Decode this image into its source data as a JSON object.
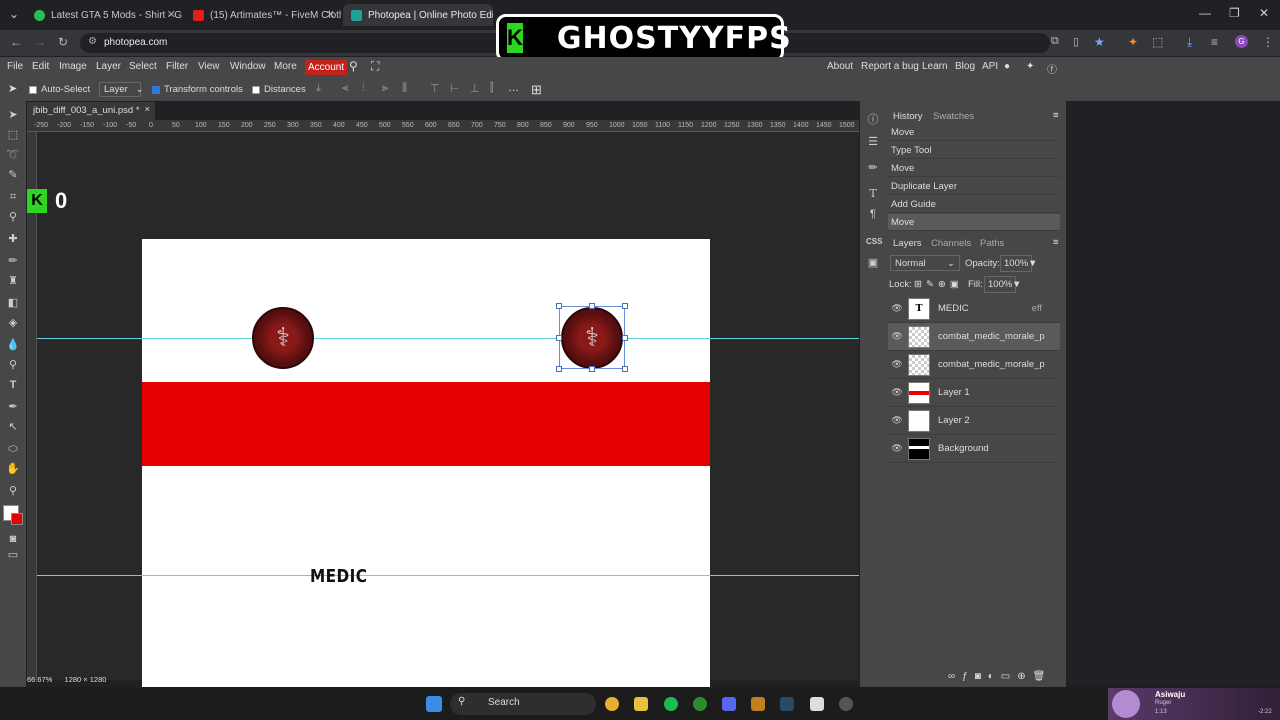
{
  "browser": {
    "tabs": [
      {
        "title": "Latest GTA 5 Mods - Shirt - GTA",
        "color": "#2dbd4e"
      },
      {
        "title": "(15) Artimates™ - FiveM Clothin",
        "color": "#e02020"
      },
      {
        "title": "Photopea | Online Photo Editor",
        "color": "#18a497"
      }
    ],
    "url": "photopea.com"
  },
  "overlay": {
    "logo_letter": "K",
    "logo_text": "GHOSTYYFPS",
    "counter_letter": "K",
    "counter_value": "0"
  },
  "menu": {
    "items": [
      "File",
      "Edit",
      "Image",
      "Layer",
      "Select",
      "Filter",
      "View",
      "Window",
      "More"
    ],
    "account": "Account",
    "right": [
      "About",
      "Report a bug",
      "Learn",
      "Blog",
      "API"
    ]
  },
  "options": {
    "auto_select": "Auto-Select",
    "layer_select": "Layer",
    "transform_controls": "Transform controls",
    "distances": "Distances"
  },
  "document": {
    "tab_name": "jbib_diff_003_a_uni.psd *",
    "close": "×",
    "text_layer": "MEDIC",
    "zoom": "66.67%",
    "size": "1280 × 1280"
  },
  "ruler": {
    "ticks": [
      "-250",
      "-200",
      "-150",
      "-100",
      "-50",
      "0",
      "50",
      "100",
      "150",
      "200",
      "250",
      "300",
      "350",
      "400",
      "450",
      "500",
      "550",
      "600",
      "650",
      "700",
      "750",
      "800",
      "850",
      "900",
      "950",
      "1000",
      "1050",
      "1100",
      "1150",
      "1200",
      "1250",
      "1300",
      "1350",
      "1400",
      "1450",
      "1500",
      "15"
    ]
  },
  "history": {
    "tabs": [
      "History",
      "Swatches"
    ],
    "items": [
      "Move",
      "Type Tool",
      "Move",
      "Duplicate Layer",
      "Add Guide",
      "Move"
    ]
  },
  "layers_panel": {
    "tabs": [
      "Layers",
      "Channels",
      "Paths"
    ],
    "blend_mode": "Normal",
    "opacity_label": "Opacity:",
    "opacity": "100%",
    "lock_label": "Lock:",
    "fill_label": "Fill:",
    "fill": "100%",
    "layers": [
      {
        "name": "MEDIC",
        "type": "text",
        "extra": "eff"
      },
      {
        "name": "combat_medic_morale_p",
        "type": "image",
        "extra": ""
      },
      {
        "name": "combat_medic_morale_p",
        "type": "image",
        "extra": ""
      },
      {
        "name": "Layer 1",
        "type": "redband",
        "extra": ""
      },
      {
        "name": "Layer 2",
        "type": "white",
        "extra": ""
      },
      {
        "name": "Background",
        "type": "black",
        "extra": ""
      }
    ]
  },
  "taskbar": {
    "search": "Search",
    "media_title": "Asiwaju",
    "media_artist": "Ruger",
    "media_time": "1:13",
    "media_remaining": "-2:22"
  },
  "colors": {
    "accent_red": "#e60000",
    "account_red": "#c1221a",
    "guide": "#5fd3e0"
  }
}
